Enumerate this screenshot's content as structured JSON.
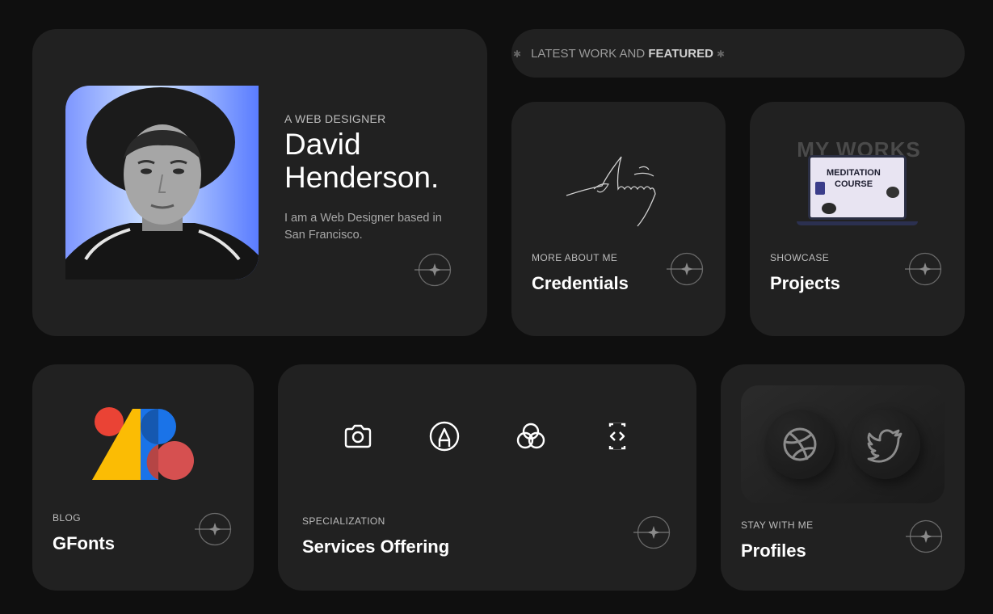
{
  "ticker": {
    "text_normal": "LATEST WORK AND ",
    "text_bold": "FEATURED"
  },
  "profile": {
    "role": "A WEB DESIGNER",
    "name_line1": "David",
    "name_line2": "Henderson.",
    "bio": "I am a Web Designer based in San Francisco."
  },
  "credentials": {
    "eyebrow": "MORE ABOUT ME",
    "title": "Credentials"
  },
  "projects": {
    "eyebrow": "SHOWCASE",
    "title": "Projects",
    "preview_heading": "MY WORKS",
    "preview_screen_line1": "MEDITATION",
    "preview_screen_line2": "COURSE"
  },
  "blog": {
    "eyebrow": "BLOG",
    "title": "GFonts"
  },
  "services": {
    "eyebrow": "SPECIALIZATION",
    "title": "Services Offering",
    "icons": [
      "camera-icon",
      "pen-nib-icon",
      "color-circles-icon",
      "code-bracket-icon"
    ]
  },
  "profiles": {
    "eyebrow": "STAY WITH ME",
    "title": "Profiles",
    "socials": [
      "dribbble-icon",
      "twitter-icon"
    ]
  },
  "colors": {
    "background": "#0f0f0f",
    "card": "#212121",
    "photo_gradient_start": "#cfe3ff",
    "photo_gradient_end": "#5a7cff"
  }
}
